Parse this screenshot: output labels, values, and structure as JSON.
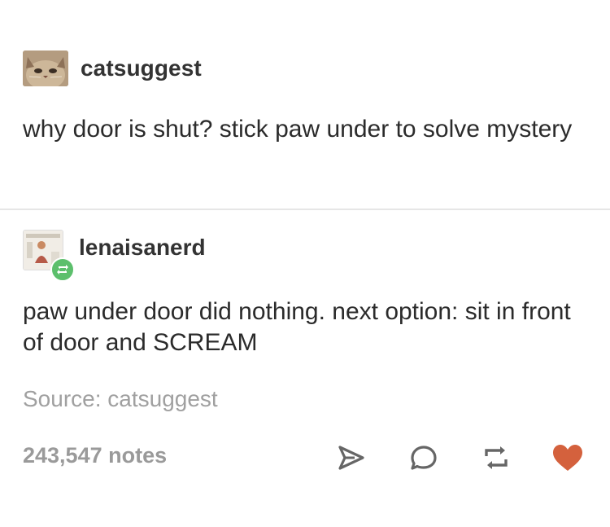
{
  "post": {
    "author": "catsuggest",
    "text": "why door is shut? stick paw under to solve mystery",
    "avatar_icon": "cat-face-avatar"
  },
  "reblog": {
    "author": "lenaisanerd",
    "text": "paw under door did nothing. next option: sit in front of door and SCREAM",
    "avatar_icon": "person-avatar",
    "badge_icon": "reblog-icon",
    "badge_color": "#5cbf6c"
  },
  "source": {
    "label": "Source:",
    "name": "catsuggest"
  },
  "footer": {
    "notes": "243,547 notes",
    "actions": [
      "share-icon",
      "reply-icon",
      "reblog-icon",
      "like-icon"
    ],
    "like_color": "#d4613d"
  }
}
